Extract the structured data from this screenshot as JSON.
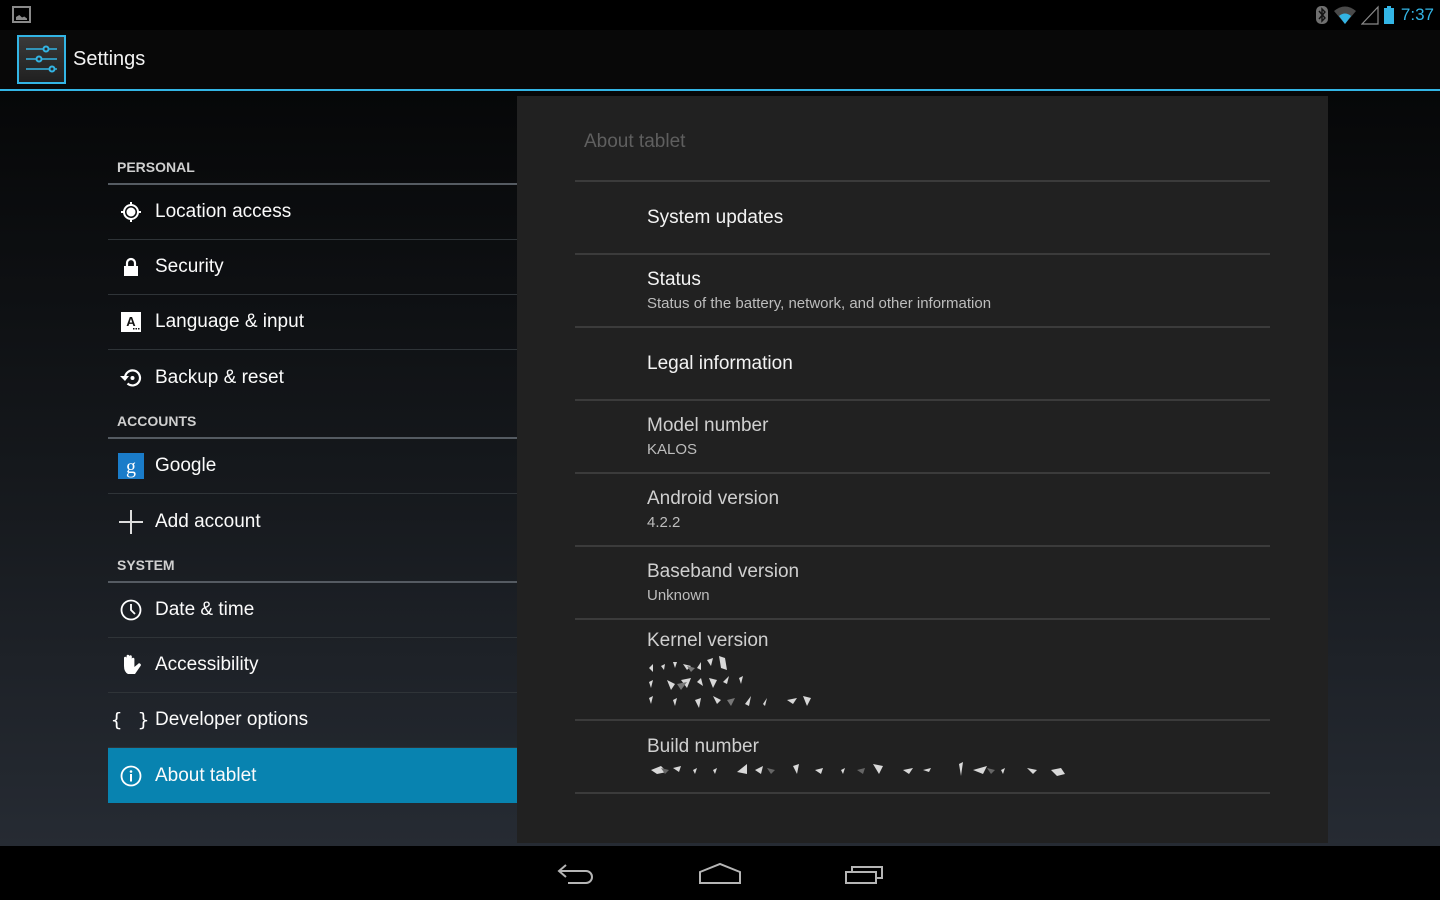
{
  "status_bar": {
    "time": "7:37",
    "icons": [
      "notification-image-icon",
      "bluetooth-icon",
      "wifi-icon",
      "cell-signal-icon",
      "battery-icon"
    ],
    "accent_color": "#33b5e5"
  },
  "action_bar": {
    "title": "Settings",
    "icon": "settings-sliders-icon"
  },
  "sidebar": {
    "categories": [
      {
        "label": "PERSONAL",
        "items": [
          {
            "label": "Location access",
            "icon": "location-target-icon"
          },
          {
            "label": "Security",
            "icon": "lock-icon"
          },
          {
            "label": "Language & input",
            "icon": "language-keyboard-icon"
          },
          {
            "label": "Backup & reset",
            "icon": "backup-restore-icon"
          }
        ]
      },
      {
        "label": "ACCOUNTS",
        "items": [
          {
            "label": "Google",
            "icon": "google-icon"
          },
          {
            "label": "Add account",
            "icon": "plus-icon"
          }
        ]
      },
      {
        "label": "SYSTEM",
        "items": [
          {
            "label": "Date & time",
            "icon": "clock-icon"
          },
          {
            "label": "Accessibility",
            "icon": "hand-icon"
          },
          {
            "label": "Developer options",
            "icon": "braces-icon"
          },
          {
            "label": "About tablet",
            "icon": "info-icon",
            "selected": true
          }
        ]
      }
    ],
    "selected_color": "#0883b0"
  },
  "detail": {
    "title": "About tablet",
    "prefs": [
      {
        "title": "System updates"
      },
      {
        "title": "Status",
        "summary": "Status of the battery, network, and other information"
      },
      {
        "title": "Legal information"
      },
      {
        "title": "Model number",
        "summary": "KALOS"
      },
      {
        "title": "Android version",
        "summary": "4.2.2"
      },
      {
        "title": "Baseband version",
        "summary": "Unknown"
      },
      {
        "title": "Kernel version",
        "summary": "[redacted]"
      },
      {
        "title": "Build number",
        "summary": "[redacted]"
      }
    ]
  },
  "nav_bar": {
    "buttons": [
      "back",
      "home",
      "recent-apps"
    ]
  }
}
